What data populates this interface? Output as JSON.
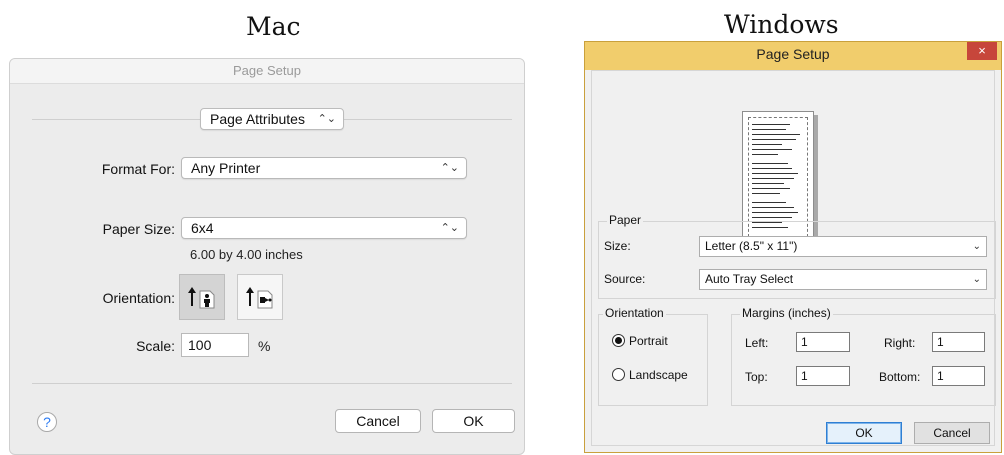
{
  "headings": {
    "mac": "Mac",
    "windows": "Windows"
  },
  "mac": {
    "window_title": "Page Setup",
    "settings_popup": "Page Attributes",
    "format_for": {
      "label": "Format For:",
      "value": "Any Printer"
    },
    "paper_size": {
      "label": "Paper Size:",
      "value": "6x4",
      "description": "6.00 by 4.00 inches"
    },
    "orientation": {
      "label": "Orientation:",
      "selected": "portrait"
    },
    "scale": {
      "label": "Scale:",
      "value": "100",
      "unit": "%"
    },
    "help_label": "?",
    "cancel_label": "Cancel",
    "ok_label": "OK"
  },
  "windows": {
    "window_title": "Page Setup",
    "close_label": "×",
    "paper": {
      "group_label": "Paper",
      "size_label": "Size:",
      "size_value": "Letter (8.5\" x 11\")",
      "source_label": "Source:",
      "source_value": "Auto Tray Select"
    },
    "orientation": {
      "group_label": "Orientation",
      "portrait_label": "Portrait",
      "landscape_label": "Landscape",
      "selected": "portrait"
    },
    "margins": {
      "group_label": "Margins (inches)",
      "left_label": "Left:",
      "left_value": "1",
      "right_label": "Right:",
      "right_value": "1",
      "top_label": "Top:",
      "top_value": "1",
      "bottom_label": "Bottom:",
      "bottom_value": "1"
    },
    "ok_label": "OK",
    "cancel_label": "Cancel"
  },
  "colors": {
    "windows_titlebar": "#f1cd6c",
    "windows_close": "#c7463b",
    "mac_window": "#ececec",
    "mac_selected_orientation": "#d4d4d4"
  }
}
